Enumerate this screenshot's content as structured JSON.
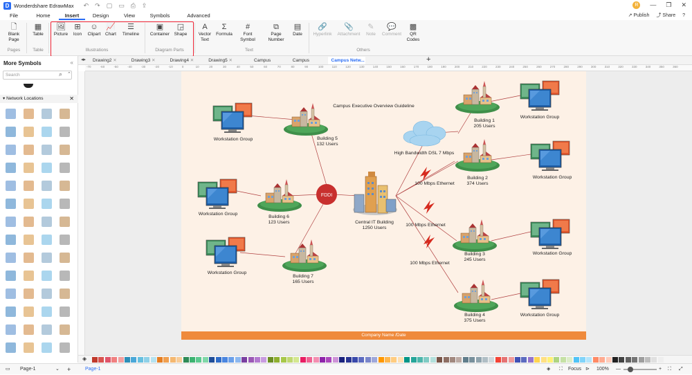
{
  "window": {
    "app_title": "Wonderdshare EdrawMax",
    "user_initial": "R"
  },
  "menu": {
    "tabs": [
      "File",
      "Home",
      "Insert",
      "Design",
      "View",
      "Symbols",
      "Advanced"
    ],
    "active": "Insert",
    "publish": "Publish",
    "share": "Share"
  },
  "ribbon": {
    "blank_page": "Blank Page",
    "table": "Table",
    "picture": "Picture",
    "icon": "Icon",
    "clipart": "Clipart",
    "chart": "Chart",
    "timeline": "Timeline",
    "container": "Container",
    "shape": "Shape",
    "vector_text": "Vector Text",
    "formula": "Formula",
    "font_symbol": "Font Symbol",
    "page_number": "Page Number",
    "date": "Date",
    "hyperlink": "Hyperlink",
    "attachment": "Attachment",
    "note": "Note",
    "comment": "Comment",
    "qr_codes": "QR Codes",
    "groups": {
      "pages": "Pages",
      "table": "Table",
      "illustrations": "Illustrations",
      "diagram_parts": "Diagram Parts",
      "text": "Text",
      "others": "Others"
    }
  },
  "left_panel": {
    "title": "More Symbols",
    "search_placeholder": "Search",
    "library": "Network Locations"
  },
  "doc_tabs": [
    "Drawing2",
    "Drawing3",
    "Drawing4",
    "Drawing5",
    "Campus Netwo...",
    "Campus Netwo...",
    "Campus Netw..."
  ],
  "active_doc_tab": 6,
  "ruler_ticks": [
    "-70",
    "-60",
    "-50",
    "-40",
    "-30",
    "-20",
    "-10",
    "0",
    "10",
    "20",
    "30",
    "40",
    "50",
    "60",
    "70",
    "80",
    "90",
    "100",
    "110",
    "120",
    "130",
    "140",
    "150",
    "160",
    "170",
    "180",
    "190",
    "200",
    "210",
    "220",
    "230",
    "240",
    "250",
    "260",
    "270",
    "280",
    "290",
    "300",
    "310",
    "320",
    "330",
    "340",
    "350",
    "360"
  ],
  "diagram": {
    "title": "Campus Executive Overview Guideline",
    "footer": "Company Name /Date",
    "fddi": "FDDI",
    "cloud": "High Bandwidth DSL 7 Mbps",
    "center": "Central IT Building",
    "center_users": "1250 Users",
    "buildings": [
      {
        "name": "Building 5",
        "users": "132 Users"
      },
      {
        "name": "Building 6",
        "users": "123 Users"
      },
      {
        "name": "Building 7",
        "users": "165 Users"
      },
      {
        "name": "Building 1",
        "users": "205 Users"
      },
      {
        "name": "Building 2",
        "users": "374 Users"
      },
      {
        "name": "Building 3",
        "users": "245 Users"
      },
      {
        "name": "Building 4",
        "users": "375 Users"
      }
    ],
    "workstation": "Workstation Group",
    "ethernet": "100 Mbps Ethernet"
  },
  "status": {
    "page_selector": "Page-1",
    "page_tab": "Page-1",
    "focus": "Focus",
    "zoom": "100%"
  },
  "colors": {
    "accent": "#2a6df4",
    "highlight": "#e23344",
    "page_bg": "#fdf1e6",
    "footer": "#ef8a3c",
    "fddi": "#c8302e",
    "grass": "#3f8f4a"
  },
  "palette": [
    "#c0392b",
    "#d9534f",
    "#e0556a",
    "#f08080",
    "#f4a0a0",
    "#2c8fb8",
    "#4aa8d8",
    "#67c0e0",
    "#8fd1e8",
    "#b5e2f0",
    "#e67e22",
    "#f0a050",
    "#f5b870",
    "#f8cc98",
    "#2e8b57",
    "#3cb371",
    "#5cc990",
    "#7fd8a8",
    "#1f4e9a",
    "#2f6cc8",
    "#4a86e0",
    "#6aa0ea",
    "#8cb8f0",
    "#7a3fa0",
    "#9b59b6",
    "#b37ad0",
    "#c89be0",
    "#6b8e23",
    "#8fb030",
    "#a8c84a",
    "#c0d870",
    "#d4e890",
    "#e91e63",
    "#f06292",
    "#f48fb1",
    "#8e24aa",
    "#ab47bc",
    "#ce93d8",
    "#1a237e",
    "#283593",
    "#3949ab",
    "#5c6bc0",
    "#7986cb",
    "#9fa8da",
    "#ff9800",
    "#ffb74d",
    "#ffcc80",
    "#ffe0b2",
    "#009688",
    "#26a69a",
    "#4db6ac",
    "#80cbc4",
    "#b2dfdb",
    "#795548",
    "#8d6e63",
    "#a1887f",
    "#bcaaa4",
    "#607d8b",
    "#78909c",
    "#90a4ae",
    "#b0bec5",
    "#cfd8dc",
    "#f44336",
    "#e57373",
    "#ef9a9a",
    "#3f51b5",
    "#5c6bc0",
    "#9575cd",
    "#ffd54f",
    "#ffe082",
    "#fff176",
    "#aed581",
    "#c5e1a5",
    "#dcedc8",
    "#4fc3f7",
    "#81d4fa",
    "#b3e5fc",
    "#ff8a65",
    "#ffab91",
    "#ffccbc",
    "#212121",
    "#424242",
    "#616161",
    "#757575",
    "#9e9e9e",
    "#bdbdbd",
    "#e0e0e0",
    "#eeeeee"
  ]
}
